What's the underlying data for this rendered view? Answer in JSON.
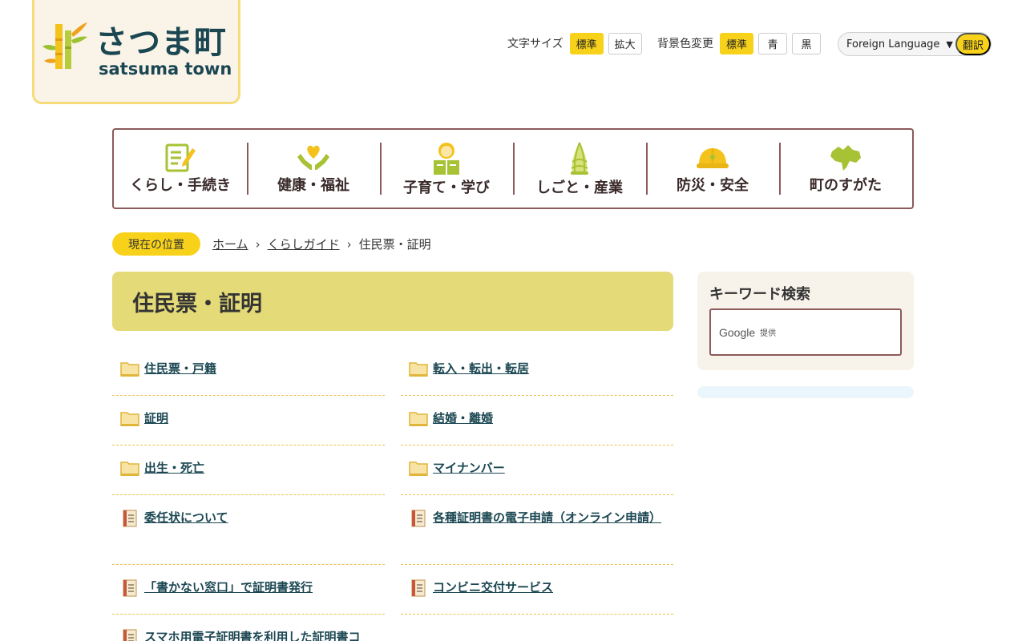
{
  "logo": {
    "name_ja": "さつま町",
    "name_en": "satsuma town"
  },
  "utility": {
    "font_size_label": "文字サイズ",
    "font_size_standard": "標準",
    "font_size_large": "拡大",
    "bg_label": "背景色変更",
    "bg_standard": "標準",
    "bg_blue": "青",
    "bg_black": "黒",
    "language_select": "Foreign Language",
    "translate_button": "翻訳"
  },
  "gnav": [
    {
      "label": "くらし・手続き",
      "icon": "document-pen-icon"
    },
    {
      "label": "健康・福祉",
      "icon": "heart-hands-icon"
    },
    {
      "label": "子育て・学び",
      "icon": "child-book-icon"
    },
    {
      "label": "しごと・産業",
      "icon": "bamboo-shoot-icon"
    },
    {
      "label": "防災・安全",
      "icon": "helmet-icon"
    },
    {
      "label": "町のすがた",
      "icon": "town-map-icon"
    }
  ],
  "breadcrumb": {
    "tag": "現在の位置",
    "home": "ホーム",
    "guide": "くらしガイド",
    "current": "住民票・証明"
  },
  "page_title": "住民票・証明",
  "links": [
    {
      "label": "住民票・戸籍",
      "icon": "folder-icon"
    },
    {
      "label": "転入・転出・転居",
      "icon": "folder-icon"
    },
    {
      "label": "証明",
      "icon": "folder-icon"
    },
    {
      "label": "結婚・離婚",
      "icon": "folder-icon"
    },
    {
      "label": "出生・死亡",
      "icon": "folder-icon"
    },
    {
      "label": "マイナンバー",
      "icon": "folder-icon"
    },
    {
      "label": "委任状について",
      "icon": "page-icon"
    },
    {
      "label": "各種証明書の電子申請（オンライン申請）",
      "icon": "page-icon"
    },
    {
      "label": "「書かない窓口」で証明書発行",
      "icon": "page-icon"
    },
    {
      "label": "コンビニ交付サービス",
      "icon": "page-icon"
    },
    {
      "label": "スマホ用電子証明書を利用した証明書コ",
      "icon": "page-icon"
    }
  ],
  "sidebar": {
    "search_title": "キーワード検索",
    "google_label": "Google",
    "google_provided": "提供"
  },
  "colors": {
    "accent_yellow": "#f8d21a",
    "title_bg": "#e4da78",
    "nav_border": "#8c5a5a",
    "link_text": "#1b4752"
  }
}
